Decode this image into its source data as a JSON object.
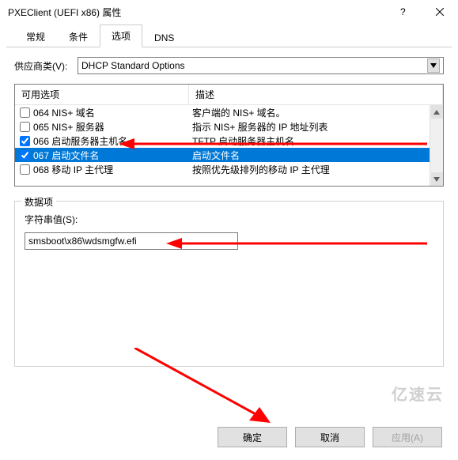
{
  "window": {
    "title": "PXEClient (UEFI x86) 属性"
  },
  "tabs": {
    "general": "常规",
    "conditions": "条件",
    "options": "选项",
    "dns": "DNS",
    "active": "options"
  },
  "vendor": {
    "label": "供应商类(V):",
    "value": "DHCP Standard Options"
  },
  "optionsTable": {
    "header1": "可用选项",
    "header2": "描述",
    "rows": [
      {
        "checked": false,
        "name": "064 NIS+ 域名",
        "desc": "客户端的 NIS+ 域名。",
        "selected": false
      },
      {
        "checked": false,
        "name": "065 NIS+ 服务器",
        "desc": "指示 NIS+ 服务器的 IP 地址列表",
        "selected": false
      },
      {
        "checked": true,
        "name": "066 启动服务器主机名",
        "desc": "TFTP 启动服务器主机名",
        "selected": false
      },
      {
        "checked": true,
        "name": "067 启动文件名",
        "desc": "启动文件名",
        "selected": true
      },
      {
        "checked": false,
        "name": "068 移动 IP 主代理",
        "desc": "按照优先级排列的移动 IP 主代理",
        "selected": false
      }
    ]
  },
  "dataGroup": {
    "legend": "数据项",
    "fieldLabel": "字符串值(S):",
    "value": "smsboot\\x86\\wdsmgfw.efi"
  },
  "buttons": {
    "ok": "确定",
    "cancel": "取消",
    "apply": "应用(A)"
  },
  "watermark": "亿速云"
}
